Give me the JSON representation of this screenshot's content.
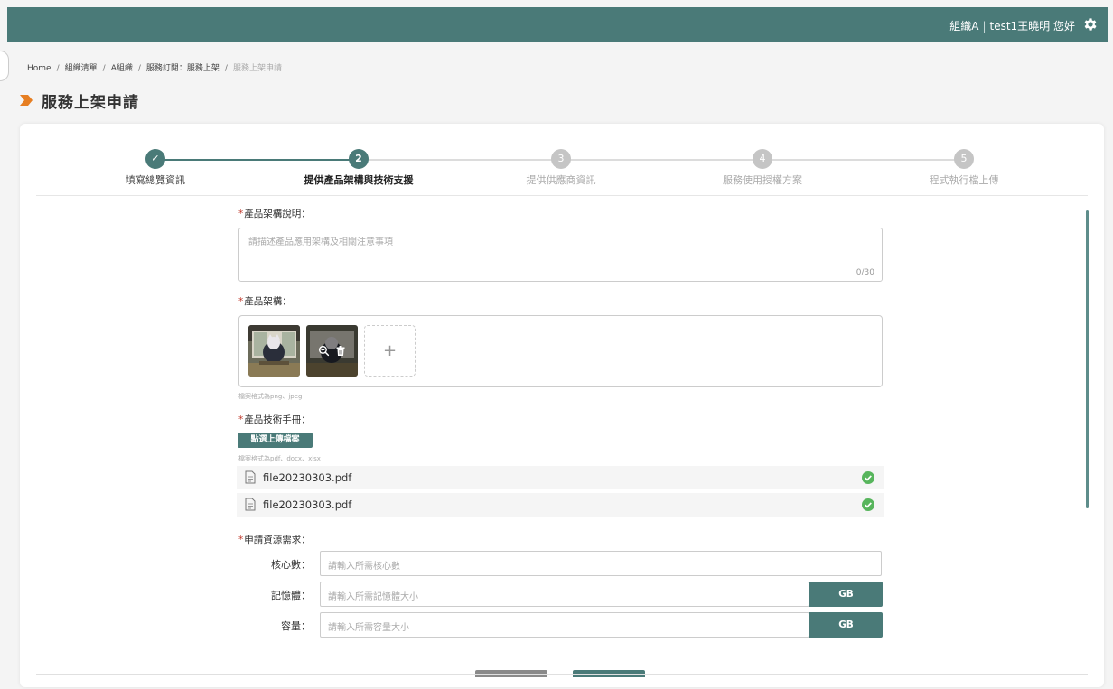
{
  "header": {
    "org": "組織A",
    "separator": "|",
    "greeting": "test1王曉明 您好",
    "icons": {
      "settings": "gear-icon"
    }
  },
  "breadcrumb": {
    "items": [
      "Home",
      "組織清單",
      "A組織",
      "服務訂閱：服務上架"
    ],
    "current": "服務上架申請"
  },
  "page": {
    "title": "服務上架申請"
  },
  "steps": [
    {
      "label": "填寫總覽資訊",
      "marker": "✓",
      "state": "done"
    },
    {
      "label": "提供產品架構與技術支援",
      "marker": "2",
      "state": "active"
    },
    {
      "label": "提供供應商資訊",
      "marker": "3",
      "state": "pending"
    },
    {
      "label": "服務使用授權方案",
      "marker": "4",
      "state": "pending"
    },
    {
      "label": "程式執行檔上傳",
      "marker": "5",
      "state": "pending"
    }
  ],
  "form": {
    "description": {
      "required": "*",
      "label": "產品架構說明：",
      "placeholder": "請描述產品應用架構及相關注意事項",
      "counter": "0/30"
    },
    "architecture": {
      "required": "*",
      "label": "產品架構：",
      "add_label": "+",
      "hint": "檔案格式為png、jpeg"
    },
    "manual": {
      "required": "*",
      "label": "產品技術手冊：",
      "upload_label": "點選上傳檔案",
      "hint": "檔案格式為pdf、docx、xlsx",
      "files": [
        {
          "name": "file20230303.pdf",
          "status": "uploaded"
        },
        {
          "name": "file20230303.pdf",
          "status": "uploaded"
        }
      ]
    },
    "resources": {
      "required": "*",
      "label": "申請資源需求：",
      "rows": [
        {
          "label": "核心數：",
          "placeholder": "請輸入所需核心數",
          "unit": ""
        },
        {
          "label": "記憶體：",
          "placeholder": "請輸入所需記憶體大小",
          "unit": "GB"
        },
        {
          "label": "容量：",
          "placeholder": "請輸入所需容量大小",
          "unit": "GB"
        }
      ]
    }
  },
  "colors": {
    "primary": "#4a7a78",
    "pending": "#c5c5c5",
    "success": "#57b55c",
    "back_button": "#8a8a8a"
  }
}
